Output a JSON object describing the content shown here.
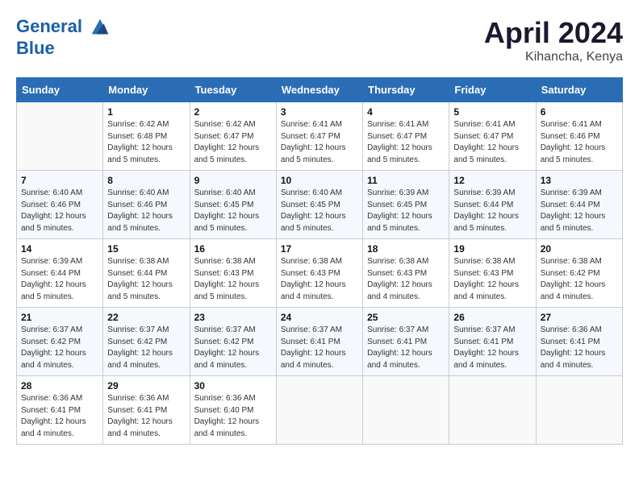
{
  "header": {
    "logo_line1": "General",
    "logo_line2": "Blue",
    "month": "April 2024",
    "location": "Kihancha, Kenya"
  },
  "weekdays": [
    "Sunday",
    "Monday",
    "Tuesday",
    "Wednesday",
    "Thursday",
    "Friday",
    "Saturday"
  ],
  "weeks": [
    [
      {
        "day": "",
        "info": ""
      },
      {
        "day": "1",
        "info": "Sunrise: 6:42 AM\nSunset: 6:48 PM\nDaylight: 12 hours\nand 5 minutes."
      },
      {
        "day": "2",
        "info": "Sunrise: 6:42 AM\nSunset: 6:47 PM\nDaylight: 12 hours\nand 5 minutes."
      },
      {
        "day": "3",
        "info": "Sunrise: 6:41 AM\nSunset: 6:47 PM\nDaylight: 12 hours\nand 5 minutes."
      },
      {
        "day": "4",
        "info": "Sunrise: 6:41 AM\nSunset: 6:47 PM\nDaylight: 12 hours\nand 5 minutes."
      },
      {
        "day": "5",
        "info": "Sunrise: 6:41 AM\nSunset: 6:47 PM\nDaylight: 12 hours\nand 5 minutes."
      },
      {
        "day": "6",
        "info": "Sunrise: 6:41 AM\nSunset: 6:46 PM\nDaylight: 12 hours\nand 5 minutes."
      }
    ],
    [
      {
        "day": "7",
        "info": "Sunrise: 6:40 AM\nSunset: 6:46 PM\nDaylight: 12 hours\nand 5 minutes."
      },
      {
        "day": "8",
        "info": "Sunrise: 6:40 AM\nSunset: 6:46 PM\nDaylight: 12 hours\nand 5 minutes."
      },
      {
        "day": "9",
        "info": "Sunrise: 6:40 AM\nSunset: 6:45 PM\nDaylight: 12 hours\nand 5 minutes."
      },
      {
        "day": "10",
        "info": "Sunrise: 6:40 AM\nSunset: 6:45 PM\nDaylight: 12 hours\nand 5 minutes."
      },
      {
        "day": "11",
        "info": "Sunrise: 6:39 AM\nSunset: 6:45 PM\nDaylight: 12 hours\nand 5 minutes."
      },
      {
        "day": "12",
        "info": "Sunrise: 6:39 AM\nSunset: 6:44 PM\nDaylight: 12 hours\nand 5 minutes."
      },
      {
        "day": "13",
        "info": "Sunrise: 6:39 AM\nSunset: 6:44 PM\nDaylight: 12 hours\nand 5 minutes."
      }
    ],
    [
      {
        "day": "14",
        "info": "Sunrise: 6:39 AM\nSunset: 6:44 PM\nDaylight: 12 hours\nand 5 minutes."
      },
      {
        "day": "15",
        "info": "Sunrise: 6:38 AM\nSunset: 6:44 PM\nDaylight: 12 hours\nand 5 minutes."
      },
      {
        "day": "16",
        "info": "Sunrise: 6:38 AM\nSunset: 6:43 PM\nDaylight: 12 hours\nand 5 minutes."
      },
      {
        "day": "17",
        "info": "Sunrise: 6:38 AM\nSunset: 6:43 PM\nDaylight: 12 hours\nand 4 minutes."
      },
      {
        "day": "18",
        "info": "Sunrise: 6:38 AM\nSunset: 6:43 PM\nDaylight: 12 hours\nand 4 minutes."
      },
      {
        "day": "19",
        "info": "Sunrise: 6:38 AM\nSunset: 6:43 PM\nDaylight: 12 hours\nand 4 minutes."
      },
      {
        "day": "20",
        "info": "Sunrise: 6:38 AM\nSunset: 6:42 PM\nDaylight: 12 hours\nand 4 minutes."
      }
    ],
    [
      {
        "day": "21",
        "info": "Sunrise: 6:37 AM\nSunset: 6:42 PM\nDaylight: 12 hours\nand 4 minutes."
      },
      {
        "day": "22",
        "info": "Sunrise: 6:37 AM\nSunset: 6:42 PM\nDaylight: 12 hours\nand 4 minutes."
      },
      {
        "day": "23",
        "info": "Sunrise: 6:37 AM\nSunset: 6:42 PM\nDaylight: 12 hours\nand 4 minutes."
      },
      {
        "day": "24",
        "info": "Sunrise: 6:37 AM\nSunset: 6:41 PM\nDaylight: 12 hours\nand 4 minutes."
      },
      {
        "day": "25",
        "info": "Sunrise: 6:37 AM\nSunset: 6:41 PM\nDaylight: 12 hours\nand 4 minutes."
      },
      {
        "day": "26",
        "info": "Sunrise: 6:37 AM\nSunset: 6:41 PM\nDaylight: 12 hours\nand 4 minutes."
      },
      {
        "day": "27",
        "info": "Sunrise: 6:36 AM\nSunset: 6:41 PM\nDaylight: 12 hours\nand 4 minutes."
      }
    ],
    [
      {
        "day": "28",
        "info": "Sunrise: 6:36 AM\nSunset: 6:41 PM\nDaylight: 12 hours\nand 4 minutes."
      },
      {
        "day": "29",
        "info": "Sunrise: 6:36 AM\nSunset: 6:41 PM\nDaylight: 12 hours\nand 4 minutes."
      },
      {
        "day": "30",
        "info": "Sunrise: 6:36 AM\nSunset: 6:40 PM\nDaylight: 12 hours\nand 4 minutes."
      },
      {
        "day": "",
        "info": ""
      },
      {
        "day": "",
        "info": ""
      },
      {
        "day": "",
        "info": ""
      },
      {
        "day": "",
        "info": ""
      }
    ]
  ]
}
